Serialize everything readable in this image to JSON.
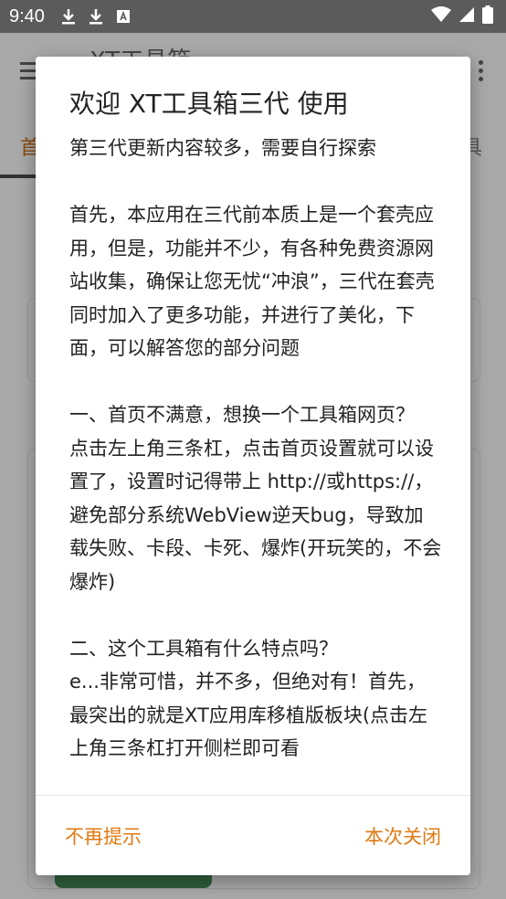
{
  "status_bar": {
    "time": "9:40",
    "icons": [
      "download-icon",
      "download-icon",
      "text-icon",
      "wifi-icon",
      "signal-icon",
      "battery-icon"
    ]
  },
  "app": {
    "title": "XT工具箱",
    "tab_left": "首",
    "tab_right": "具"
  },
  "dialog": {
    "title": "欢迎 XT工具箱三代 使用",
    "body": "第三代更新内容较多，需要自行探索\n\n首先，本应用在三代前本质上是一个套壳应用，但是，功能并不少，有各种免费资源网站收集，确保让您无忧“冲浪”，三代在套壳同时加入了更多功能，并进行了美化，下面，可以解答您的部分问题\n\n一、首页不满意，想换一个工具箱网页？\n点击左上角三条杠，点击首页设置就可以设置了，设置时记得带上 http://或https://，避免部分系统WebView逆天bug，导致加载失败、卡段、卡死、爆炸(开玩笑的，不会爆炸)\n\n二、这个工具箱有什么特点吗？\ne...非常可惜，并不多，但绝对有！首先，最突出的就是XT应用库移植版板块(点击左上角三条杠打开侧栏即可看",
    "button_left": "不再提示",
    "button_right": "本次关闭"
  },
  "colors": {
    "accent": "#e07a12",
    "scrim": "#9a9a9a",
    "status_bar": "#5b5b5b"
  }
}
